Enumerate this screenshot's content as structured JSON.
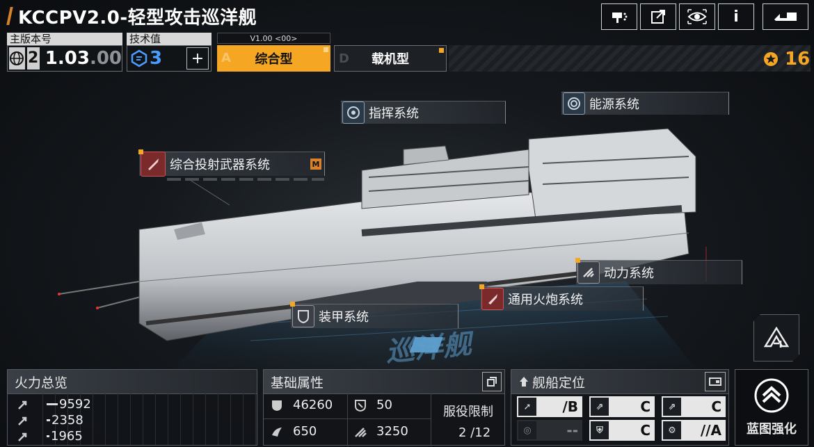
{
  "header": {
    "title": "KCCPV2.0-轻型攻击巡洋舰",
    "buttons": [
      "paint-icon",
      "share-icon",
      "view-icon",
      "info-icon",
      "back-icon"
    ],
    "info_glyph": "i"
  },
  "version": {
    "label": "主版本号",
    "major": "2",
    "minor": "1.03",
    "minor_suffix": ".00"
  },
  "tech": {
    "label": "技术值",
    "value": "3",
    "plus": "+"
  },
  "config": {
    "version_tag": "V1.00 <00>",
    "tabs": [
      {
        "letter": "A",
        "label": "综合型",
        "active": true
      },
      {
        "letter": "D",
        "label": "载机型",
        "active": false
      }
    ]
  },
  "currency": {
    "value": "16"
  },
  "systems": {
    "command": "指挥系统",
    "energy": "能源系统",
    "projectile": "综合投射武器系统",
    "projectile_badge": "M",
    "power": "动力系统",
    "cannon": "通用火炮系统",
    "armor": "装甲系统"
  },
  "hologram_text": "巡洋舰",
  "firepower": {
    "title": "火力总览",
    "rows": [
      {
        "value": "9592"
      },
      {
        "value": "2358"
      },
      {
        "value": "1965"
      }
    ]
  },
  "attributes": {
    "title": "基础属性",
    "hp": "46260",
    "armor": "50",
    "shield": "650",
    "speed": "3250",
    "service_label": "服役限制",
    "service_value": "2 /12"
  },
  "positioning": {
    "title": "舰船定位",
    "ranks": [
      {
        "value": "/B"
      },
      {
        "value": "C"
      },
      {
        "value": "C"
      },
      {
        "value": "--"
      },
      {
        "value": "C"
      },
      {
        "value": "//A"
      }
    ]
  },
  "upgrade": {
    "label": "蓝图强化"
  },
  "colors": {
    "accent": "#f5a623",
    "tech_blue": "#4a9cff"
  }
}
